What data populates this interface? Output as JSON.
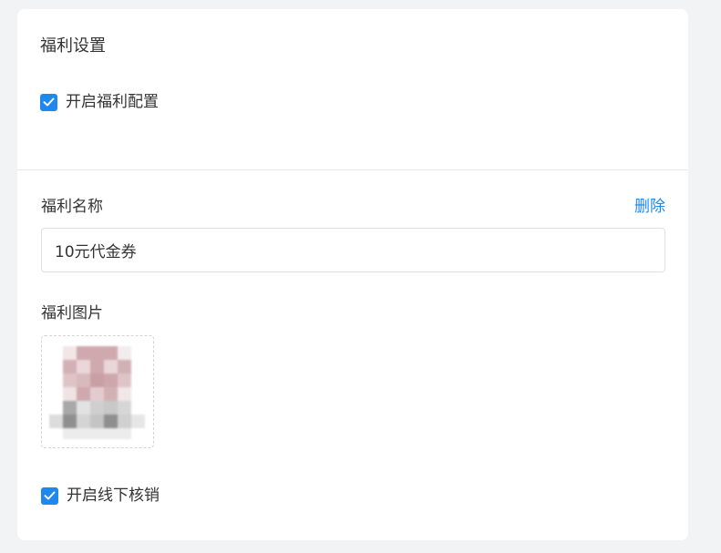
{
  "card": {
    "title": "福利设置",
    "enable_benefit": {
      "label": "开启福利配置",
      "checked": true
    }
  },
  "benefit": {
    "name_label": "福利名称",
    "delete_label": "删除",
    "name_value": "10元代金券",
    "image_label": "福利图片",
    "image_icon": "blurred-thumbnail-icon",
    "offline_redeem": {
      "label": "开启线下核销",
      "checked": true
    }
  },
  "colors": {
    "accent": "#1e88ef",
    "page_bg": "#f2f3f5",
    "card_bg": "#ffffff",
    "border": "#dcdfe6"
  }
}
